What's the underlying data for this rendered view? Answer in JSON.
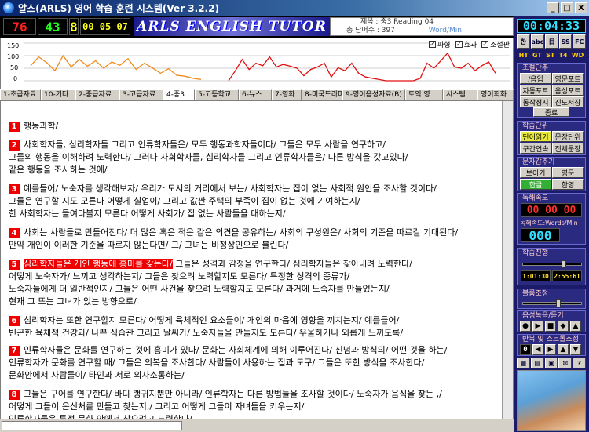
{
  "window": {
    "title": "알스(ARLS) 영어 학습 훈련 시스템(Ver 3.2.2)",
    "controls": [
      "_",
      "□",
      "X"
    ]
  },
  "header": {
    "led1": "76",
    "led2": "43",
    "led3": "8",
    "timer": "00 05 07",
    "logo": "ARLS ENGLISH TUTOR",
    "subject_label": "제목 : 중3 Reading 04",
    "words_label": "총 단어수 : 397",
    "speed_label": "Word/Min"
  },
  "graph": {
    "checks": [
      {
        "label": "파형",
        "checked": true
      },
      {
        "label": "효과",
        "checked": true
      },
      {
        "label": "조절판",
        "checked": true
      }
    ],
    "ticks": [
      "150",
      "100",
      "50",
      "0"
    ],
    "colors": {
      "orange": "#f28a1a",
      "red": "#e01010",
      "grid": "#cfcfcf"
    }
  },
  "chart_data": {
    "type": "line",
    "ylim": [
      0,
      150
    ],
    "series": [
      {
        "values": [
          60,
          95,
          72,
          40,
          100,
          55,
          85,
          58,
          80,
          50,
          75,
          62,
          88,
          45,
          70,
          52,
          30,
          48,
          22,
          18,
          10,
          5
        ]
      },
      {
        "values": [
          0,
          40,
          85,
          45,
          70,
          60,
          95,
          55,
          65,
          58,
          50,
          20,
          45,
          55,
          70,
          15,
          52,
          40,
          70,
          30,
          15,
          10,
          5,
          0,
          0,
          0,
          0,
          0,
          10,
          70,
          50,
          80,
          110,
          55,
          50,
          70,
          40,
          60,
          75,
          30
        ]
      }
    ]
  },
  "tabs": [
    "1-초급자료",
    "10-기타",
    "2-중급자료",
    "3-고급자료",
    "4-중3",
    "5-고등학교",
    "6-뉴스",
    "7-영화",
    "8-미국드라마",
    "9-영어음성자료(B)",
    "토익 영",
    "시스템",
    "영어회화"
  ],
  "main": {
    "active_tab": 4,
    "paragraphs": [
      {
        "num": "1",
        "lines": [
          "행동과학/"
        ]
      },
      {
        "num": "2",
        "lines": [
          "사회학자들, 심리학자들 그리고 인류학자들은/ 모두 행동과학자들이다/ 그들은 모두 사람을 연구하고/",
          "그들의 행동을 이해하려 노력한다/ 그러나 사회학자들, 심리학자들 그리고 인류학자들은/ 다른 방식을 갖고있다/",
          "같은 행동을 조사하는 것에/"
        ]
      },
      {
        "num": "3",
        "lines": [
          "예를들어/ 노숙자를 생각해보자/ 우리가 도시의 거리에서 보는/ 사회학자는 집이 없는 사회적 원인을 조사할 것이다/",
          "그들은 연구할 지도 모른다 어떻게 실업이/ 그리고 값싼 주택의 부족이 집이 없는 것에 기여하는지/",
          "한 사회학자는 들여다볼지 모른다 어떻게 사회가/ 집 없는 사람들을 대하는지/"
        ]
      },
      {
        "num": "4",
        "lines": [
          "사회는 사람들로 만들어진다/ 더 많은 혹은 적은 같은 의견을 공유하는/ 사회의 구성원은/ 사회의 기준을 따르길 기대된다/",
          "만약 개인이 이러한 기준을 따르지 않는다면/ 그/ 그녀는 비정상인으로 불린다/"
        ]
      },
      {
        "num": "5",
        "highlight": "심리학자들은 개인 행동에 흥미를 갖는다/",
        "lines": [
          " 그들은 성격과 감정을 연구한다/ 심리학자들은 찾아내려 노력한다/",
          "어떻게 노숙자가/ 느끼고 생각하는지/ 그들은 찾으려 노력할지도 모른다/ 특정한 성격의 종류가/",
          "노숙자들에게 더 일반적인지/ 그들은 어떤 사건을 찾으려 노력할지도 모른다/ 과거에 노숙자를 만들었는지/",
          "현재 그 또는 그녀가 있는 방향으로/"
        ]
      },
      {
        "num": "6",
        "lines": [
          "심리학자는 또한 연구할지 모른다/ 어떻게 육체적인 요소들이/ 개인의 마음에 영향을 끼치는지/ 예를들어/",
          "빈곤한 육체적 건강과/ 나쁜 식습관 그리고 날씨가/ 노숙자들을 만들지도 모른다/ 우울하거나 외롭게 느끼도록/"
        ]
      },
      {
        "num": "7",
        "lines": [
          "인류학자들은 문화를 연구하는 것에 흥미가 있다/ 문화는 사회체계에 의해 이루어진다/ 신념과 방식의/ 어떤 것을 하는/",
          "인류학자가 문화를 연구할 때/ 그들은 의복을 조사한다/ 사람들이 사용하는 집과 도구/ 그들은 또한 방식을 조사한다/",
          "문화안에서 사람들이/ 타인과 서로 의사소통하는/"
        ]
      },
      {
        "num": "8",
        "lines": [
          "그들은 구어를 연구한다/ 바디 랭귀지뿐만 아니라/ 인류학자는 다른 방법들을 조사할 것이다/ 노숙자가 음식을 찾는 ,/",
          "어떻게 그들이 은신처를 만들고 찾는지,/ 그리고 어떻게 그들이 자녀들을 키우는지/",
          "인류학자들은 특정 문화 안에서 찾으려고 노력한다/"
        ]
      }
    ]
  },
  "right_panel": {
    "clock": "00:04:33",
    "top_icons": [
      "한",
      "abc",
      "目",
      "SS",
      "FC"
    ],
    "modes": [
      "HT",
      "GT",
      "ST",
      "T4",
      "WD"
    ],
    "control_title": "조절단추",
    "control_buttons": [
      "/음입",
      "영문포트",
      "자동포트",
      "음성포트",
      "동작정지",
      "진도저장",
      "종료"
    ],
    "learn_title": "학습단위",
    "learn_buttons": [
      "단어읽기",
      "문장단위",
      "구간연속",
      "전체문장"
    ],
    "view_title": "문자감추기",
    "view_buttons": [
      "보이기",
      "영문",
      "한글",
      "한영"
    ],
    "reading_speed_title": "독해속도",
    "reading_speed_value": "00 00 00",
    "speed_label": "독해속도:Words/Min",
    "speed_digits": "000",
    "progress_title": "학습진행",
    "progress_a": "1:01:30",
    "progress_b": "2:55:61",
    "progress_fraction": 0.7,
    "volume_title": "볼륨조정",
    "volume_fraction": 0.6,
    "playback_title": "음성녹음/듣기",
    "repeat_title": "반복 및 스크롤조정",
    "repeat_value": "0"
  }
}
